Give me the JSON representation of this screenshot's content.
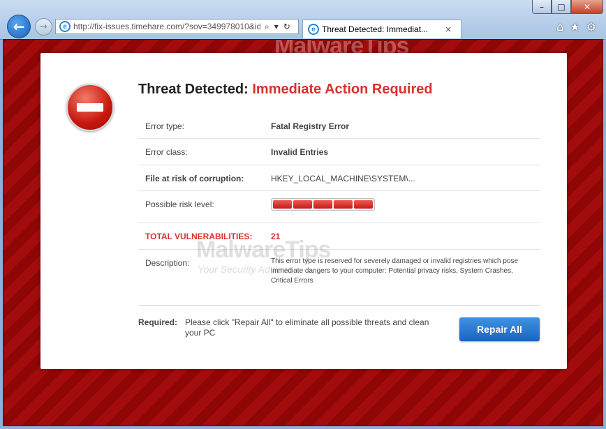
{
  "browser": {
    "url": "http://fix-issues.timehare.com/?sov=349978010&id",
    "tab_title": "Threat Detected: Immediat...",
    "tab_close": "×",
    "nav_back": "←",
    "nav_forward": "→",
    "search_glyph": "⌕",
    "dropdown_glyph": "▾",
    "refresh_glyph": "↻",
    "ie_logo": "e",
    "tools": {
      "home": "⌂",
      "favorites": "★",
      "settings": "⚙"
    },
    "window_controls": {
      "minimize": "–",
      "maximize": "□",
      "close": "✕"
    }
  },
  "alert": {
    "title_prefix": "Threat Detected: ",
    "title_accent": "Immediate Action Required",
    "rows": [
      {
        "label": "Error type:",
        "value": "Fatal Registry Error"
      },
      {
        "label": "Error class:",
        "value": "Invalid Entries"
      },
      {
        "label": "File at risk of corruption:",
        "value": "HKEY_LOCAL_MACHINE\\SYSTEM\\..."
      },
      {
        "label": "Possible risk level:",
        "risk_segments": 5
      },
      {
        "label": "TOTAL VULNERABILITIES:",
        "value": "21"
      },
      {
        "label": "Description:",
        "value": "This error type is reserved for severely damaged or invalid registries which pose immediate dangers to your computer: Potential privacy risks, System Crashes, Critical Errors"
      }
    ],
    "required_label": "Required:",
    "required_text": "Please click \"Repair All\" to eliminate all possible threats and clean your PC",
    "repair_button": "Repair All"
  },
  "watermark": {
    "brand": "MalwareTips",
    "tagline": "Your Security Advisor"
  },
  "colors": {
    "accent_red": "#d8312c",
    "background_red": "#a30c0c",
    "button_blue": "#1a64c2"
  }
}
